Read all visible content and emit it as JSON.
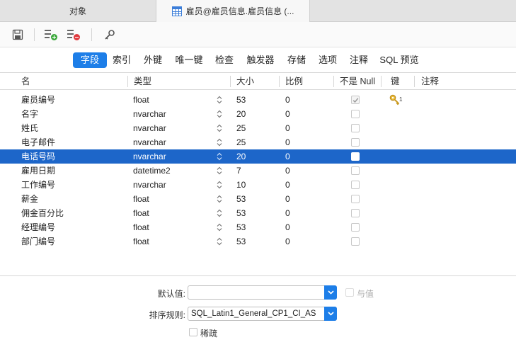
{
  "tabs": [
    {
      "label": "对象"
    },
    {
      "label": "雇员@雇员信息.雇员信息 (..."
    }
  ],
  "segments": [
    {
      "label": "字段",
      "active": true
    },
    {
      "label": "索引"
    },
    {
      "label": "外键"
    },
    {
      "label": "唯一键"
    },
    {
      "label": "检查"
    },
    {
      "label": "触发器"
    },
    {
      "label": "存储"
    },
    {
      "label": "选项"
    },
    {
      "label": "注释"
    },
    {
      "label": "SQL 预览"
    }
  ],
  "columns": {
    "name": "名",
    "type": "类型",
    "size": "大小",
    "scale": "比例",
    "notnull": "不是 Null",
    "key": "键",
    "comment": "注释"
  },
  "rows": [
    {
      "name": "雇员编号",
      "type": "float",
      "size": "53",
      "scale": "0",
      "notnull": true,
      "key": "1"
    },
    {
      "name": "名字",
      "type": "nvarchar",
      "size": "20",
      "scale": "0",
      "notnull": false
    },
    {
      "name": "姓氏",
      "type": "nvarchar",
      "size": "25",
      "scale": "0",
      "notnull": false
    },
    {
      "name": "电子邮件",
      "type": "nvarchar",
      "size": "25",
      "scale": "0",
      "notnull": false
    },
    {
      "name": "电话号码",
      "type": "nvarchar",
      "size": "20",
      "scale": "0",
      "notnull": false,
      "selected": true
    },
    {
      "name": "雇用日期",
      "type": "datetime2",
      "size": "7",
      "scale": "0",
      "notnull": false
    },
    {
      "name": "工作编号",
      "type": "nvarchar",
      "size": "10",
      "scale": "0",
      "notnull": false
    },
    {
      "name": "薪金",
      "type": "float",
      "size": "53",
      "scale": "0",
      "notnull": false
    },
    {
      "name": "佣金百分比",
      "type": "float",
      "size": "53",
      "scale": "0",
      "notnull": false
    },
    {
      "name": "经理编号",
      "type": "float",
      "size": "53",
      "scale": "0",
      "notnull": false
    },
    {
      "name": "部门编号",
      "type": "float",
      "size": "53",
      "scale": "0",
      "notnull": false
    }
  ],
  "bottom": {
    "default_label": "默认值:",
    "default_value": "",
    "and_value_label": "与值",
    "collation_label": "排序规则:",
    "collation_value": "SQL_Latin1_General_CP1_CI_AS",
    "sparse_label": "稀疏"
  },
  "colors": {
    "accent": "#1d7ee8",
    "selection": "#1d66c9"
  }
}
